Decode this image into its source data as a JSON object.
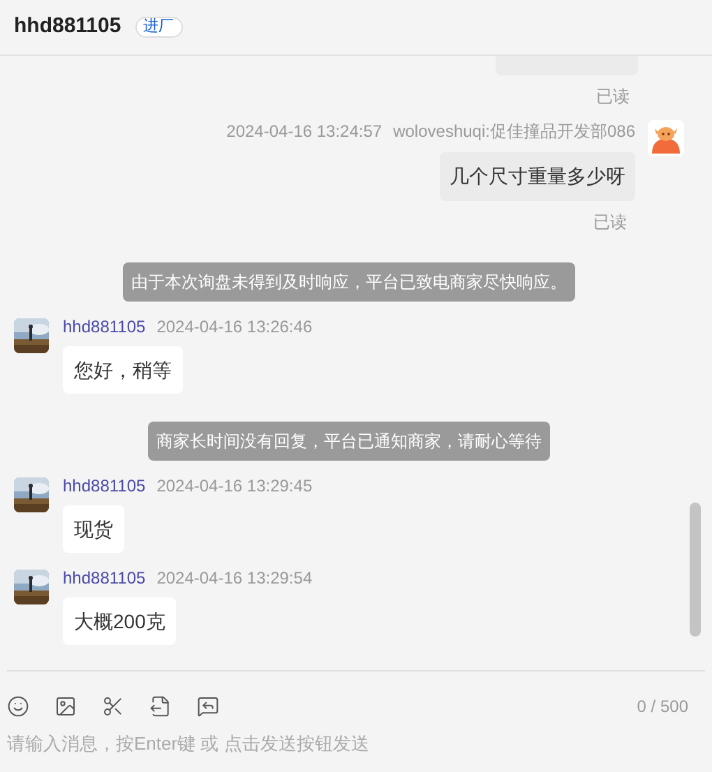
{
  "header": {
    "title": "hhd881105",
    "tag": "进厂"
  },
  "messages": [
    {
      "kind": "outgoing_cut",
      "status": "已读"
    },
    {
      "kind": "outgoing",
      "time": "2024-04-16 13:24:57",
      "sender": "woloveshuqi:促佳撞品开发部086",
      "text": "几个尺寸重量多少呀",
      "status": "已读"
    },
    {
      "kind": "system",
      "text": "由于本次询盘未得到及时响应，平台已致电商家尽快响应。"
    },
    {
      "kind": "incoming",
      "sender": "hhd881105",
      "time": "2024-04-16 13:26:46",
      "text": "您好，稍等"
    },
    {
      "kind": "system",
      "text": "商家长时间没有回复，平台已通知商家，请耐心等待"
    },
    {
      "kind": "incoming",
      "sender": "hhd881105",
      "time": "2024-04-16 13:29:45",
      "text": "现货"
    },
    {
      "kind": "incoming",
      "sender": "hhd881105",
      "time": "2024-04-16 13:29:54",
      "text": "大概200克"
    }
  ],
  "composer": {
    "counter": "0 / 500",
    "placeholder": "请输入消息，按Enter键 或 点击发送按钮发送"
  }
}
